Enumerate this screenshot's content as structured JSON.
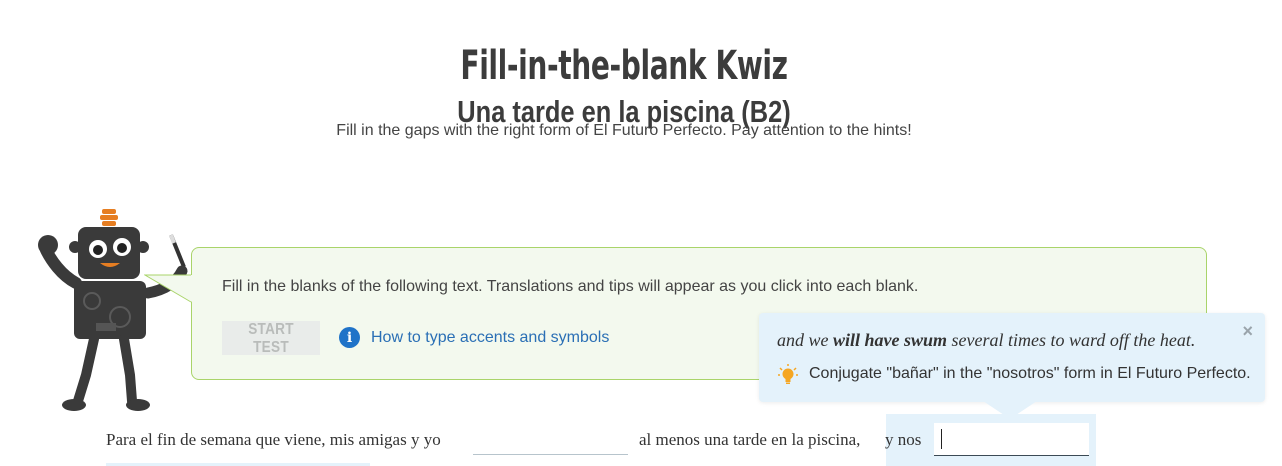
{
  "header": {
    "title": "Fill-in-the-blank Kwiz",
    "subtitle": "Una tarde en la piscina (B2)",
    "instructions": "Fill in the gaps with the right form of El Futuro Perfecto. Pay attention to the hints!"
  },
  "panel": {
    "text": "Fill in the blanks of the following text. Translations and tips will appear as you click into each blank.",
    "start_label": "START TEST",
    "accents_link": "How to type accents and symbols",
    "colors": {
      "background": "#f3f9ee",
      "border": "#a9d46a",
      "link": "#2a6fb5"
    }
  },
  "tooltip": {
    "translation_before": "and we ",
    "translation_bold": "will have swum",
    "translation_after": " several times to ward off the heat.",
    "hint": "Conjugate \"bañar\" in the \"nosotros\" form in El Futuro Perfecto.",
    "close_symbol": "×",
    "colors": {
      "background": "#e4f2fb",
      "bulb": "#f5a623"
    }
  },
  "sentence": {
    "part1": "Para el fin de semana que viene, mis amigas y yo",
    "blank1_value": "",
    "part2": "al menos una tarde en la piscina,",
    "part3": "y nos",
    "blank2_value": ""
  },
  "icons": {
    "info": "info-icon",
    "bulb": "lightbulb-icon",
    "close": "close-icon",
    "mascot": "robot-mascot"
  }
}
